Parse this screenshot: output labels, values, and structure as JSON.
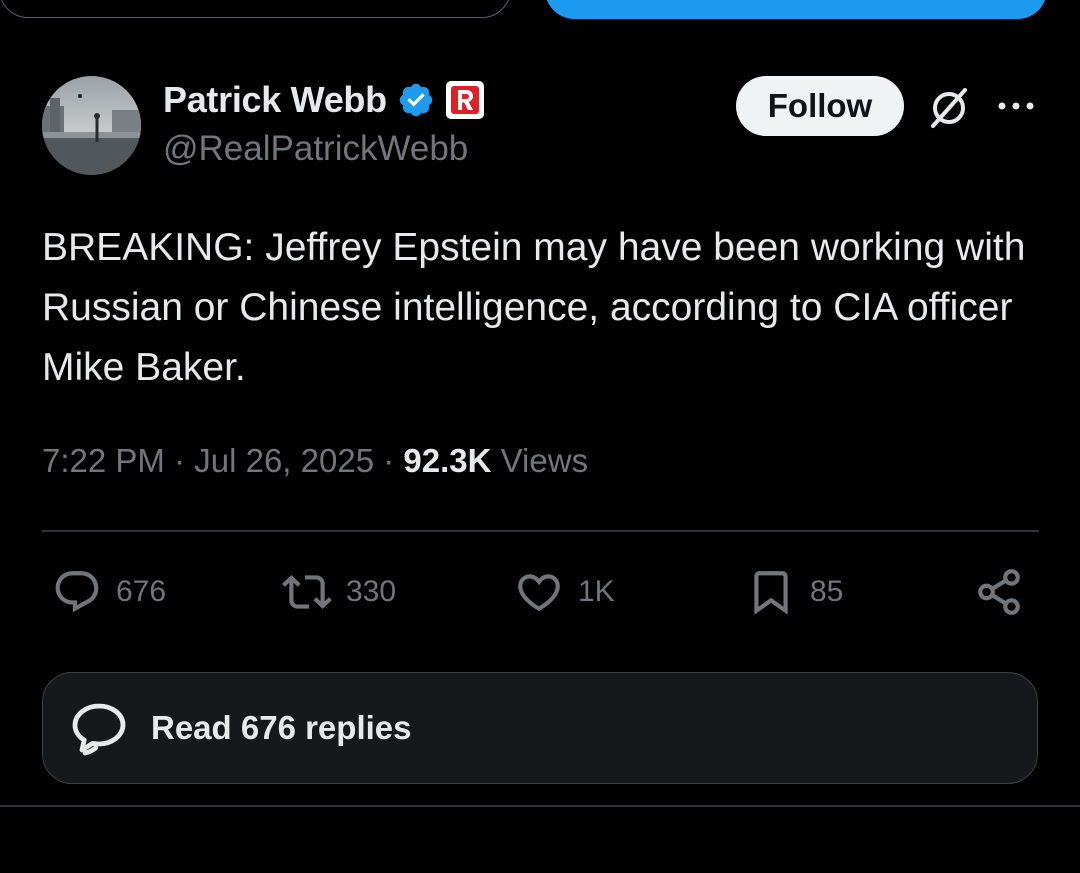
{
  "author": {
    "name": "Patrick Webb",
    "handle": "@RealPatrickWebb",
    "verified_icon": "verified-badge-icon",
    "affiliate_icon": "affiliate-badge-icon"
  },
  "header": {
    "follow_label": "Follow",
    "grok_icon": "grok-icon",
    "more_icon": "more-options-icon"
  },
  "tweet": {
    "text": "BREAKING: Jeffrey Epstein may have been working with Russian or Chinese intelligence, according to CIA officer Mike Baker.",
    "time": "7:22 PM",
    "sep1": "·",
    "date": "Jul 26, 2025",
    "sep2": "·",
    "views_count": "92.3K",
    "views_label": "Views"
  },
  "actions": {
    "replies": "676",
    "reposts": "330",
    "likes": "1K",
    "bookmarks": "85"
  },
  "read_replies": {
    "label": "Read 676 replies"
  },
  "colors": {
    "background": "#000000",
    "accent": "#1d9bf0",
    "muted": "#71767b",
    "text": "#e7e9ea",
    "affiliate_red": "#e02027"
  }
}
